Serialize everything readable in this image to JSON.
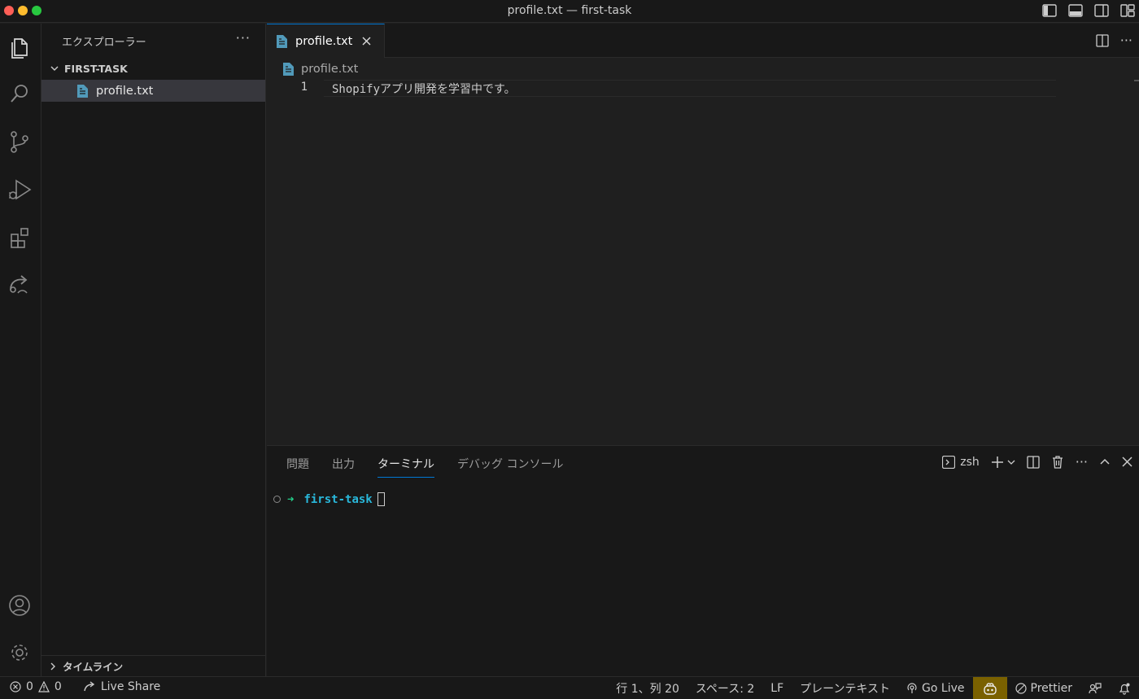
{
  "window": {
    "title": "profile.txt — first-task"
  },
  "activity_bar": {
    "items": [
      "explorer-icon",
      "search-icon",
      "source-control-icon",
      "run-debug-icon",
      "extensions-icon",
      "remote-explorer-icon"
    ],
    "bottom": [
      "account-icon",
      "gear-icon"
    ]
  },
  "sidebar": {
    "title": "エクスプローラー",
    "folder": "FIRST-TASK",
    "files": [
      {
        "name": "profile.txt"
      }
    ],
    "timeline": "タイムライン"
  },
  "editor": {
    "tab": {
      "label": "profile.txt"
    },
    "breadcrumb": "profile.txt",
    "lines": [
      {
        "number": "1",
        "text": "Shopifyアプリ開発を学習中です。"
      }
    ]
  },
  "panel": {
    "tabs": [
      "問題",
      "出力",
      "ターミナル",
      "デバッグ コンソール"
    ],
    "active_tab": "ターミナル",
    "shell": "zsh",
    "terminal": {
      "arrow": "➜",
      "dir": "first-task"
    }
  },
  "status_bar": {
    "errors": "0",
    "warnings": "0",
    "live_share": "Live Share",
    "position": "行 1、列 20",
    "spaces": "スペース: 2",
    "eol": "LF",
    "language": "プレーンテキスト",
    "go_live": "Go Live",
    "prettier": "Prettier"
  },
  "colors": {
    "accent": "#0078d4",
    "file_icon": "#519aba",
    "terminal_green": "#23d18b",
    "terminal_cyan": "#29b8db",
    "copilot_bg": "#7a6100"
  }
}
